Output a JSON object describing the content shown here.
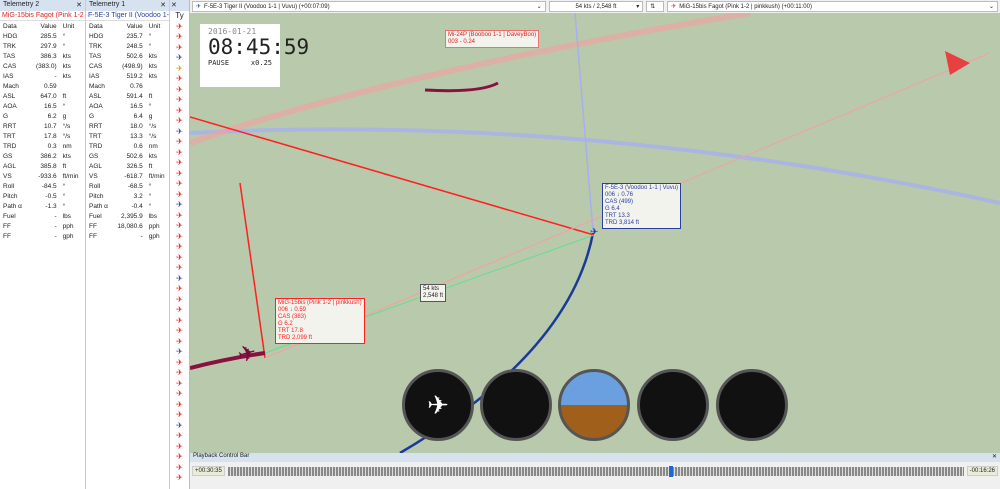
{
  "telemetry2": {
    "title": "Telemetry 2",
    "subject": "MiG-15bis Fagot (Pink 1-2 | pinkkush)",
    "headers": [
      "Data",
      "Value",
      "Unit"
    ],
    "rows": [
      [
        "HDG",
        "285.5",
        "°"
      ],
      [
        "TRK",
        "297.9",
        "°"
      ],
      [
        "TAS",
        "386.3",
        "kts"
      ],
      [
        "CAS",
        "(383.0)",
        "kts"
      ],
      [
        "IAS",
        "-",
        "kts"
      ],
      [
        "Mach",
        "0.59",
        ""
      ],
      [
        "ASL",
        "647.0",
        "ft"
      ],
      [
        "AOA",
        "16.5",
        "°"
      ],
      [
        "G",
        "6.2",
        "g"
      ],
      [
        "RRT",
        "10.7",
        "°/s"
      ],
      [
        "TRT",
        "17.8",
        "°/s"
      ],
      [
        "TRD",
        "0.3",
        "nm"
      ],
      [
        "GS",
        "386.2",
        "kts"
      ],
      [
        "AGL",
        "385.8",
        "ft"
      ],
      [
        "VS",
        "-933.6",
        "ft/min"
      ],
      [
        "Roll",
        "-84.5",
        "°"
      ],
      [
        "Pitch",
        "-0.5",
        "°"
      ],
      [
        "Path α",
        "-1.3",
        "°"
      ],
      [
        "Fuel",
        "-",
        "lbs"
      ],
      [
        "FF",
        "-",
        "pph"
      ],
      [
        "FF",
        "-",
        "gph"
      ]
    ]
  },
  "telemetry1": {
    "title": "Telemetry 1",
    "subject": "F-5E-3 Tiger II (Voodoo 1-1 | Vuvu)",
    "headers": [
      "Data",
      "Value",
      "Unit"
    ],
    "rows": [
      [
        "HDG",
        "235.7",
        "°"
      ],
      [
        "TRK",
        "248.5",
        "°"
      ],
      [
        "TAS",
        "502.6",
        "kts"
      ],
      [
        "CAS",
        "(498.9)",
        "kts"
      ],
      [
        "IAS",
        "519.2",
        "kts"
      ],
      [
        "Mach",
        "0.76",
        ""
      ],
      [
        "ASL",
        "591.4",
        "ft"
      ],
      [
        "AOA",
        "16.5",
        "°"
      ],
      [
        "G",
        "6.4",
        "g"
      ],
      [
        "RRT",
        "18.0",
        "°/s"
      ],
      [
        "TRT",
        "13.3",
        "°/s"
      ],
      [
        "TRD",
        "0.6",
        "nm"
      ],
      [
        "GS",
        "502.6",
        "kts"
      ],
      [
        "AGL",
        "326.5",
        "ft"
      ],
      [
        "VS",
        "-618.7",
        "ft/min"
      ],
      [
        "Roll",
        "-68.5",
        "°"
      ],
      [
        "Pitch",
        "3.2",
        "°"
      ],
      [
        "Path α",
        "-0.4",
        "°"
      ],
      [
        "Fuel",
        "2,395.9",
        "lbs"
      ],
      [
        "FF",
        "18,080.6",
        "pph"
      ],
      [
        "FF",
        "-",
        "gph"
      ]
    ]
  },
  "typecol": {
    "header": "Ty"
  },
  "topbar": {
    "left_aircraft": "F-5E-3 Tiger II (Voodoo 1-1 | Vuvu) (+00:07:09)",
    "distance": "54 kts / 2,548 ft",
    "right_aircraft": "MiG-15bis Fagot (Pink 1-2 | pinkkush) (+00:11:00)"
  },
  "clock": {
    "date": "2016-01-21",
    "time": "08:45:59",
    "state": "PAUSE",
    "speed": "x0.25"
  },
  "labels": {
    "mi24": [
      "Mi-24P (Booboo 1-1 | DaveyBoo)",
      "003 - 0.24"
    ],
    "f5": [
      "F-5E-3 (Voodoo 1-1 | Vuvu)",
      "006 ↓ 0.76",
      "CAS (499)",
      "G 6.4",
      "TRT 13.3",
      "TRD 3,814 ft"
    ],
    "mig": [
      "MiG-15bis (Pink 1-2 | pinkkush)",
      "006 ↓ 0.59",
      "CAS (383)",
      "G 6.2",
      "TRT 17.8",
      "TRD 2,099 ft"
    ],
    "range": [
      "54 kts",
      "2,548 ft"
    ]
  },
  "playback": {
    "title": "Playback Control Bar",
    "elapsed": "+00:30:35",
    "remaining": "-00:16:26",
    "progress": 0.6
  },
  "colors": {
    "red": "#ff2020",
    "blue": "#1a3a9a"
  }
}
